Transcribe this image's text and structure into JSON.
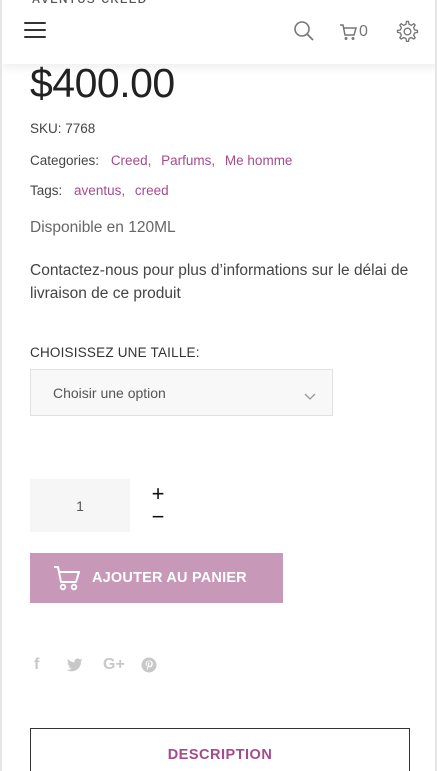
{
  "header": {
    "clipped_title": "ᴀᴠᴇɴᴛᴜs ᴄʀᴇᴇᴅ",
    "cart_count": "0",
    "icons": [
      "hamburger-menu-icon",
      "search-icon",
      "cart-icon",
      "gear-icon"
    ]
  },
  "product": {
    "price": "$400.00",
    "sku_label": "SKU:",
    "sku": "7768",
    "categories_label": "Categories:",
    "categories": [
      "Creed",
      "Parfums",
      "Me homme"
    ],
    "tags_label": "Tags:",
    "tags": [
      "aventus",
      "creed"
    ],
    "availability": "Disponible en 120ML",
    "contact_note": "Contactez-nous pour plus d’informations sur le délai de livraison de ce produit"
  },
  "variation": {
    "label": "CHOISISSEZ UNE TAILLE:",
    "selected": "Choisir une option"
  },
  "quantity": {
    "value": "1",
    "plus": "+",
    "minus": "−"
  },
  "cart_button": {
    "label": "AJOUTER AU PANIER",
    "color": "#c898b8"
  },
  "social": {
    "facebook": "f",
    "google_plus": "G+"
  },
  "tabs": {
    "description": "DESCRIPTION"
  },
  "colors": {
    "accent": "#a54b8c",
    "button": "#c898b8"
  }
}
